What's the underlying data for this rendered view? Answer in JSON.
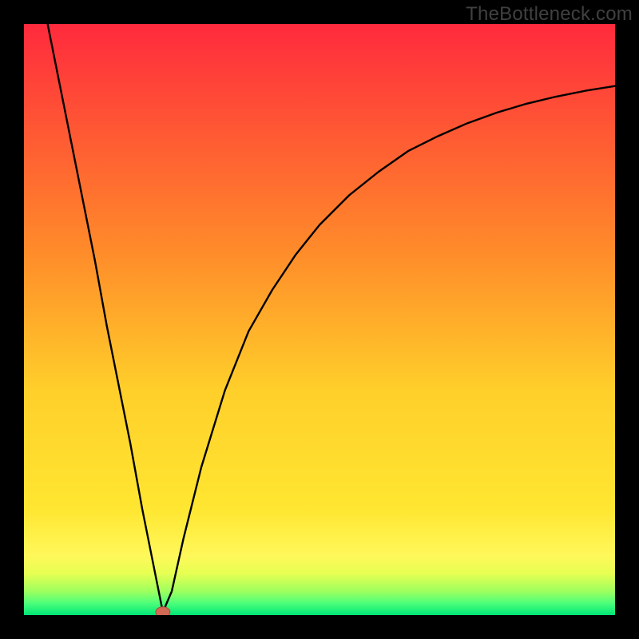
{
  "watermark": "TheBottleneck.com",
  "colors": {
    "frame": "#000000",
    "top": "#ff2a3d",
    "mid": "#ffe631",
    "green_band_top": "#e6ff52",
    "green_band_bottom": "#00e676",
    "curve": "#000000",
    "marker_fill": "#d06a55",
    "marker_stroke": "#b24a39"
  },
  "chart_data": {
    "type": "line",
    "title": "",
    "xlabel": "",
    "ylabel": "",
    "xlim": [
      0,
      100
    ],
    "ylim": [
      0,
      100
    ],
    "series": [
      {
        "name": "curve",
        "x": [
          4,
          6,
          8,
          10,
          12,
          14,
          16,
          18,
          20,
          22,
          23.5,
          25,
          27,
          30,
          34,
          38,
          42,
          46,
          50,
          55,
          60,
          65,
          70,
          75,
          80,
          85,
          90,
          95,
          100
        ],
        "y": [
          100,
          90,
          80,
          70,
          60,
          49,
          39,
          29,
          18,
          8,
          0.5,
          4,
          13,
          25,
          38,
          48,
          55,
          61,
          66,
          71,
          75,
          78.5,
          81,
          83.2,
          85,
          86.5,
          87.7,
          88.7,
          89.5
        ]
      }
    ],
    "marker": {
      "x": 23.5,
      "y": 0.5
    },
    "background_bands": [
      {
        "y0": 100,
        "y1": 8,
        "type": "gradient",
        "from": "#ff2a3d",
        "to": "#ffe631"
      },
      {
        "y0": 8,
        "y1": 3,
        "type": "gradient",
        "from": "#ffe631",
        "to": "#e6ff52"
      },
      {
        "y0": 3,
        "y1": 0,
        "type": "gradient",
        "from": "#7fff5e",
        "to": "#00e676"
      }
    ]
  }
}
